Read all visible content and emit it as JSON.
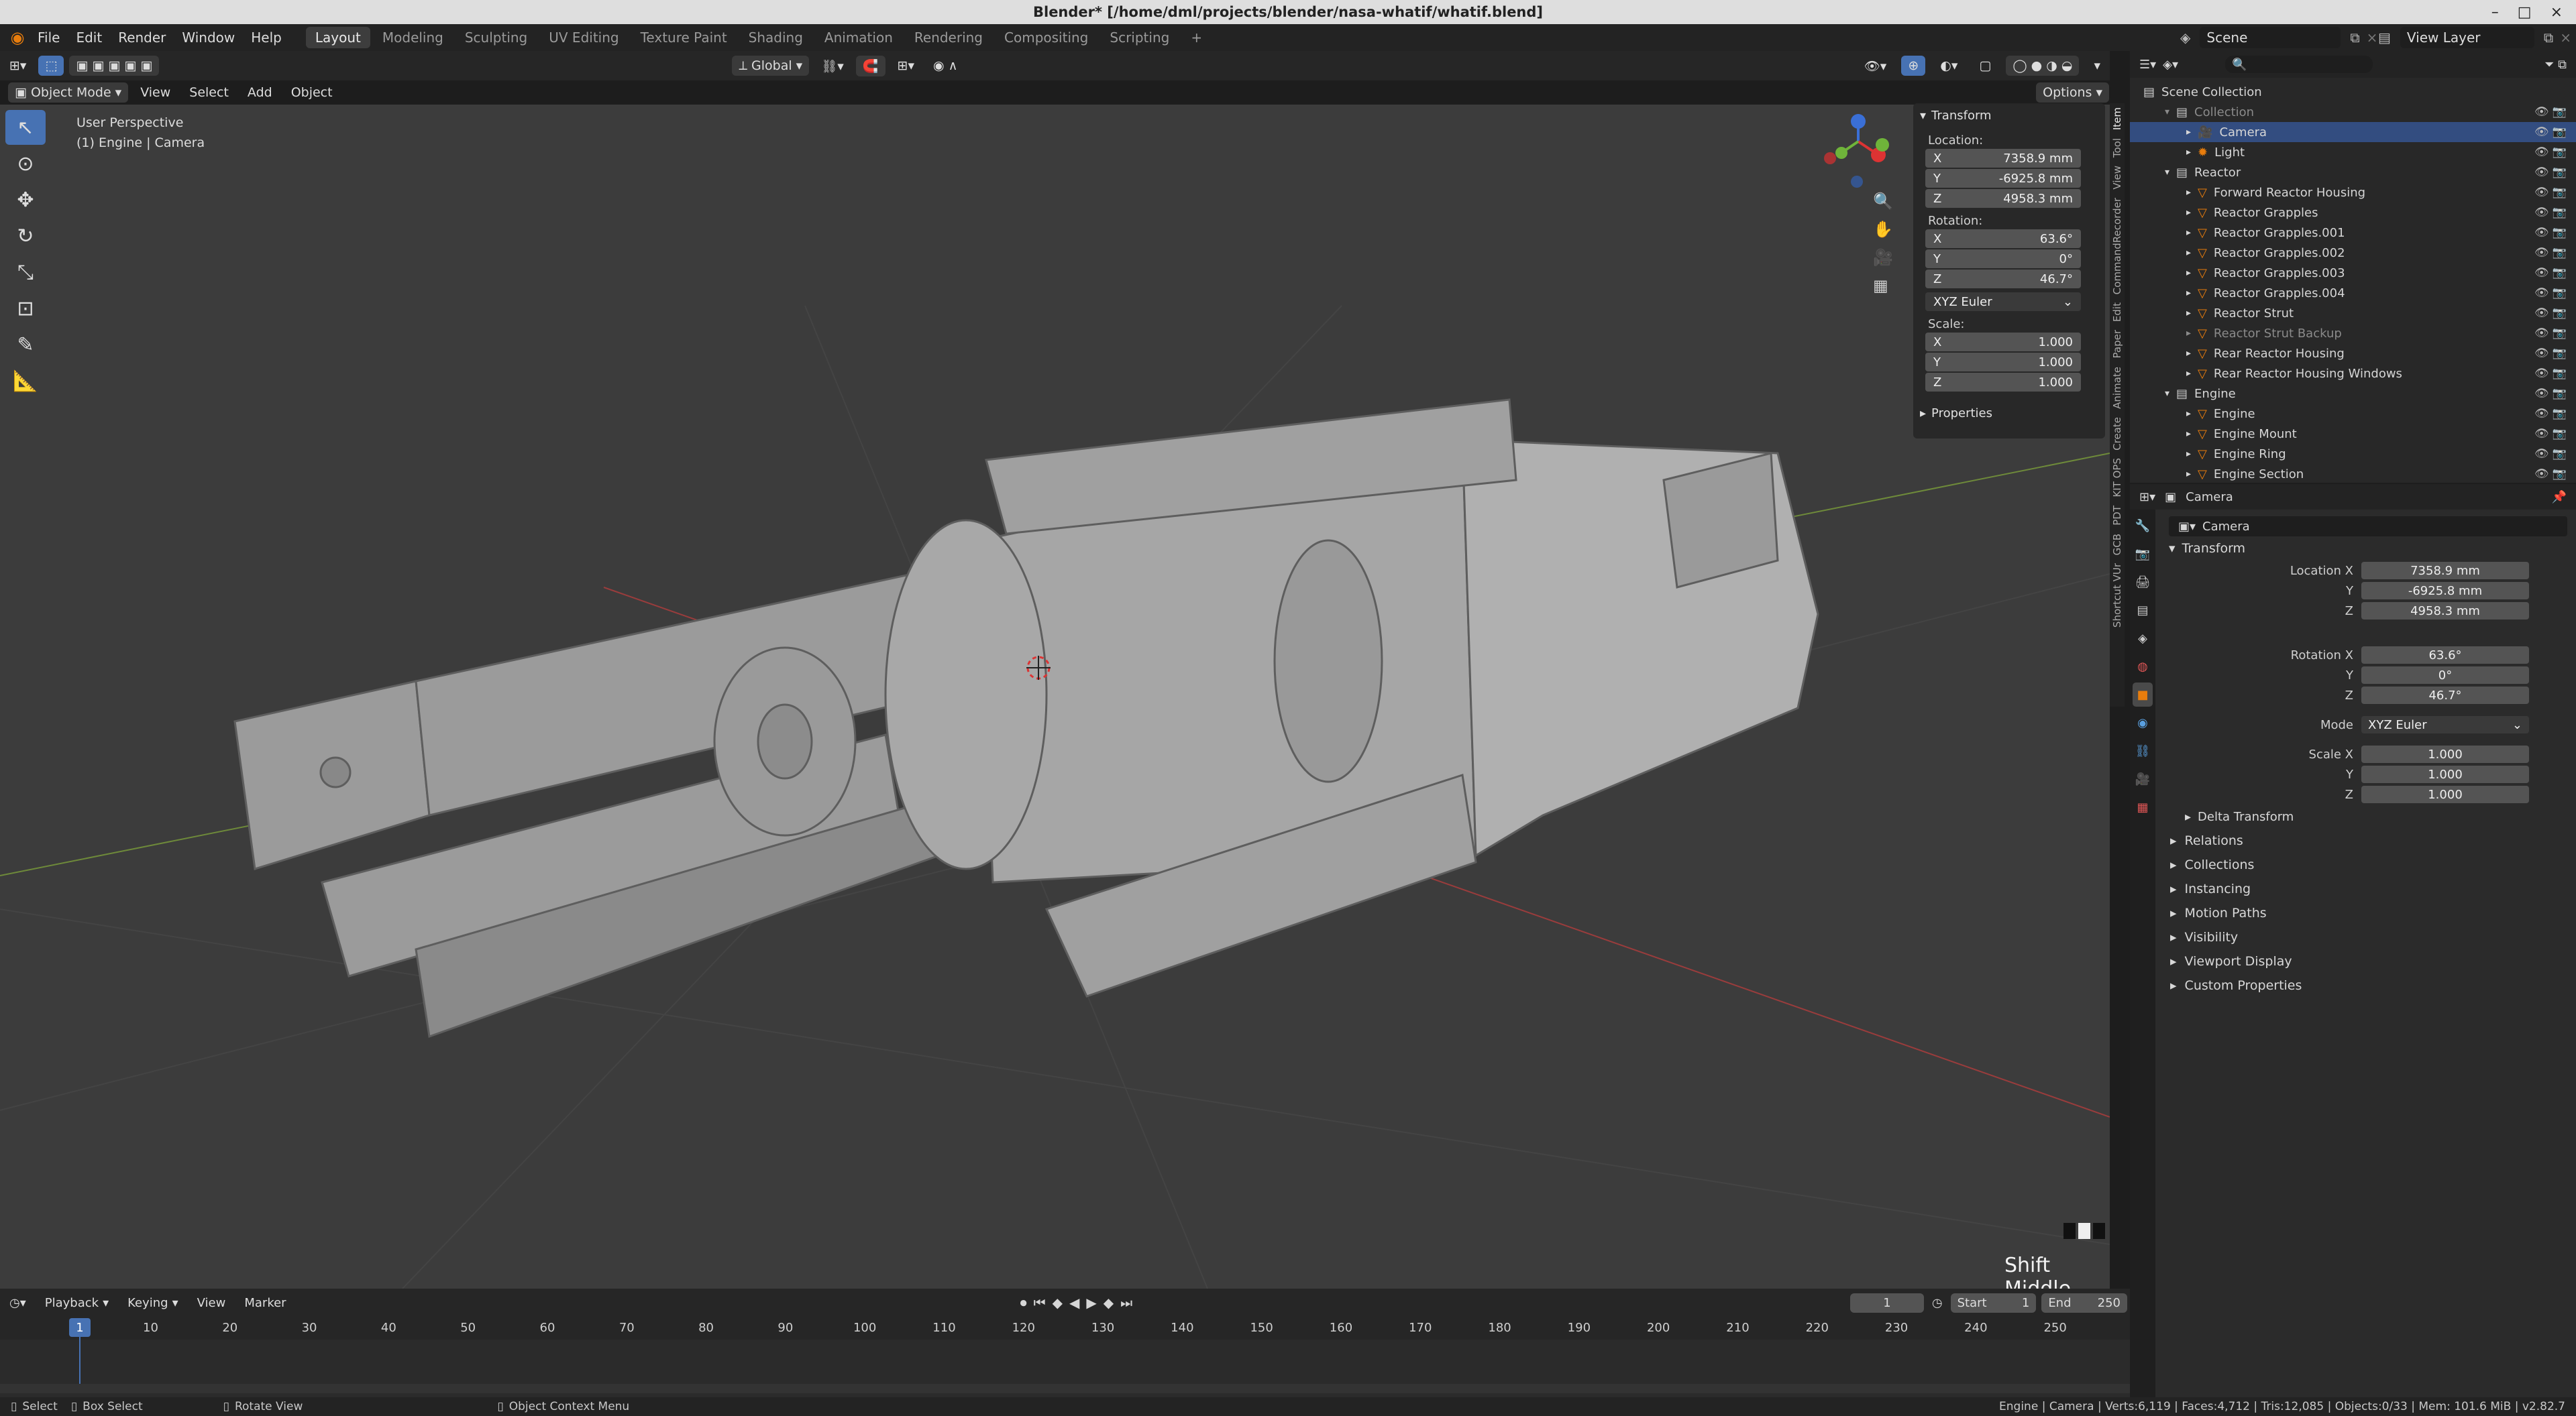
{
  "window": {
    "title": "Blender* [/home/dml/projects/blender/nasa-whatif/whatif.blend]"
  },
  "menu": [
    "File",
    "Edit",
    "Render",
    "Window",
    "Help"
  ],
  "workspaces": [
    {
      "label": "Layout",
      "active": true
    },
    {
      "label": "Modeling"
    },
    {
      "label": "Sculpting"
    },
    {
      "label": "UV Editing"
    },
    {
      "label": "Texture Paint"
    },
    {
      "label": "Shading"
    },
    {
      "label": "Animation"
    },
    {
      "label": "Rendering"
    },
    {
      "label": "Compositing"
    },
    {
      "label": "Scripting"
    }
  ],
  "scene": {
    "name": "Scene",
    "view_layer": "View Layer"
  },
  "viewport_header": {
    "mode": "Object Mode",
    "view": "View",
    "select": "Select",
    "add": "Add",
    "object": "Object",
    "transform_orientation": "Global",
    "options": "Options"
  },
  "viewport": {
    "perspective": "User Perspective",
    "context": "(1) Engine | Camera",
    "hint": "Shift Middle"
  },
  "npanel": {
    "transform_title": "Transform",
    "location_label": "Location:",
    "location": [
      {
        "axis": "X",
        "value": "7358.9 mm"
      },
      {
        "axis": "Y",
        "value": "-6925.8 mm"
      },
      {
        "axis": "Z",
        "value": "4958.3 mm"
      }
    ],
    "rotation_label": "Rotation:",
    "rotation": [
      {
        "axis": "X",
        "value": "63.6°"
      },
      {
        "axis": "Y",
        "value": "0°"
      },
      {
        "axis": "Z",
        "value": "46.7°"
      }
    ],
    "rotation_mode": "XYZ Euler",
    "scale_label": "Scale:",
    "scale": [
      {
        "axis": "X",
        "value": "1.000"
      },
      {
        "axis": "Y",
        "value": "1.000"
      },
      {
        "axis": "Z",
        "value": "1.000"
      }
    ],
    "properties_title": "Properties"
  },
  "side_tabs": [
    "Item",
    "Tool",
    "View",
    "CommandRecorder",
    "Edit",
    "Paper",
    "Animate",
    "Create",
    "KIT OPS",
    "PDT",
    "GCB",
    "Shortcut VUr"
  ],
  "outliner": {
    "root": "Scene Collection",
    "rows": [
      {
        "label": "Collection",
        "indent": 1,
        "icon": "collection",
        "dim": true
      },
      {
        "label": "Camera",
        "indent": 2,
        "icon": "camera",
        "selected": true
      },
      {
        "label": "Light",
        "indent": 2,
        "icon": "light"
      },
      {
        "label": "Reactor",
        "indent": 1,
        "icon": "collection"
      },
      {
        "label": "Forward Reactor Housing",
        "indent": 2,
        "icon": "mesh"
      },
      {
        "label": "Reactor Grapples",
        "indent": 2,
        "icon": "mesh"
      },
      {
        "label": "Reactor Grapples.001",
        "indent": 2,
        "icon": "mesh"
      },
      {
        "label": "Reactor Grapples.002",
        "indent": 2,
        "icon": "mesh"
      },
      {
        "label": "Reactor Grapples.003",
        "indent": 2,
        "icon": "mesh"
      },
      {
        "label": "Reactor Grapples.004",
        "indent": 2,
        "icon": "mesh"
      },
      {
        "label": "Reactor Strut",
        "indent": 2,
        "icon": "mesh"
      },
      {
        "label": "Reactor Strut Backup",
        "indent": 2,
        "icon": "mesh",
        "dim": true
      },
      {
        "label": "Rear Reactor Housing",
        "indent": 2,
        "icon": "mesh"
      },
      {
        "label": "Rear Reactor Housing Windows",
        "indent": 2,
        "icon": "mesh"
      },
      {
        "label": "Engine",
        "indent": 1,
        "icon": "collection"
      },
      {
        "label": "Engine",
        "indent": 2,
        "icon": "mesh"
      },
      {
        "label": "Engine Mount",
        "indent": 2,
        "icon": "mesh"
      },
      {
        "label": "Engine Ring",
        "indent": 2,
        "icon": "mesh"
      },
      {
        "label": "Engine Section",
        "indent": 2,
        "icon": "mesh"
      }
    ]
  },
  "properties": {
    "object_name": "Camera",
    "data_name": "Camera",
    "transform_title": "Transform",
    "location": [
      {
        "label": "Location X",
        "value": "7358.9 mm"
      },
      {
        "label": "Y",
        "value": "-6925.8 mm"
      },
      {
        "label": "Z",
        "value": "4958.3 mm"
      }
    ],
    "rotation": [
      {
        "label": "Rotation X",
        "value": "63.6°"
      },
      {
        "label": "Y",
        "value": "0°"
      },
      {
        "label": "Z",
        "value": "46.7°"
      }
    ],
    "mode_label": "Mode",
    "mode": "XYZ Euler",
    "scale": [
      {
        "label": "Scale X",
        "value": "1.000"
      },
      {
        "label": "Y",
        "value": "1.000"
      },
      {
        "label": "Z",
        "value": "1.000"
      }
    ],
    "delta": "Delta Transform",
    "sections": [
      "Relations",
      "Collections",
      "Instancing",
      "Motion Paths",
      "Visibility",
      "Viewport Display",
      "Custom Properties"
    ]
  },
  "timeline": {
    "menus": [
      "Playback",
      "Keying",
      "View",
      "Marker"
    ],
    "current_frame": "1",
    "start_label": "Start",
    "start": "1",
    "end_label": "End",
    "end": "250",
    "ticks": [
      "10",
      "20",
      "30",
      "40",
      "50",
      "60",
      "70",
      "80",
      "90",
      "100",
      "110",
      "120",
      "130",
      "140",
      "150",
      "160",
      "170",
      "180",
      "190",
      "200",
      "210",
      "220",
      "230",
      "240",
      "250"
    ]
  },
  "statusbar": {
    "select": "Select",
    "box_select": "Box Select",
    "rotate_view": "Rotate View",
    "context_menu": "Object Context Menu",
    "stats": "Engine | Camera | Verts:6,119 | Faces:4,712 | Tris:12,085 | Objects:0/33 | Mem: 101.6 MiB | v2.82.7"
  }
}
